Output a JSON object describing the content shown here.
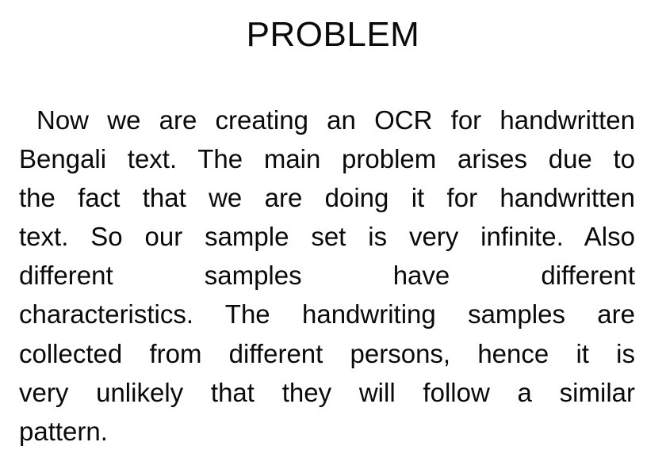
{
  "title": "PROBLEM",
  "paragraph_lines": [
    "Now we are creating an OCR for handwritten",
    "Bengali text. The main problem arises due to",
    "the fact that we are doing it for handwritten",
    "text. So our sample set is very infinite. Also",
    "different samples have different",
    "characteristics. The handwriting samples are",
    "collected from different persons, hence it is",
    "very unlikely that they will follow  a similar",
    "pattern."
  ]
}
